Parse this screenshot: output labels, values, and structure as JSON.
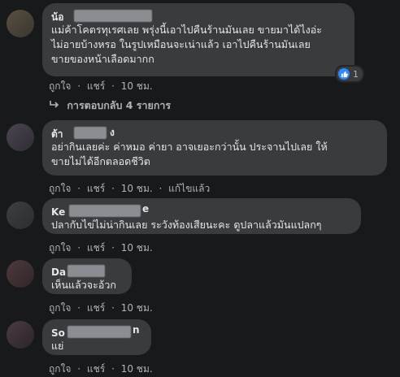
{
  "comments": [
    {
      "name_prefix": "น้อ",
      "lines": [
        "แม่ค้าโคตรทุเรศเลย พรุ่งนี้เอาไปคืนร้านมันเลย ขายมาได้ไงอ่ะ",
        "ไม่อายบ้างหรอ ในรูปเหมือนจะเน่าแล้ว เอาไปคืนร้านมันเลย",
        "ขายของหน้าเลือดมากก"
      ],
      "like": "ถูกใจ",
      "reply": "แชร์",
      "time": "10 ชม.",
      "reaction_count": "1"
    },
    {
      "name_prefix": "ต้า",
      "name_suffix": "ง",
      "lines": [
        "อย่ากินเลยค่ะ ค่าหมอ ค่ายา อาจเยอะกว่านั้น ประจานไปเลย ให้",
        "ขายไม่ได้อีกตลอดชีวิต"
      ],
      "like": "ถูกใจ",
      "reply": "แชร์",
      "time": "10 ชม.",
      "edited": "แก้ไขแล้ว"
    },
    {
      "name_prefix": "Ke",
      "name_suffix": "e",
      "lines": [
        "ปลากับไข่ไม่น่ากินเลย ระวังท้องเสียนะคะ ดูปลาแล้วมันแปลกๆ"
      ],
      "like": "ถูกใจ",
      "reply": "แชร์",
      "time": "10 ชม."
    },
    {
      "name_prefix": "Da",
      "lines": [
        "เห็นแล้วจะอ้วก"
      ],
      "like": "ถูกใจ",
      "reply": "แชร์",
      "time": "10 ชม."
    },
    {
      "name_prefix": "So",
      "name_suffix": "n",
      "lines": [
        "แย่"
      ],
      "like": "ถูกใจ",
      "reply": "แชร์",
      "time": "10 ชม."
    }
  ],
  "replies_label": "การตอบกลับ 4 รายการ",
  "dot": "·"
}
